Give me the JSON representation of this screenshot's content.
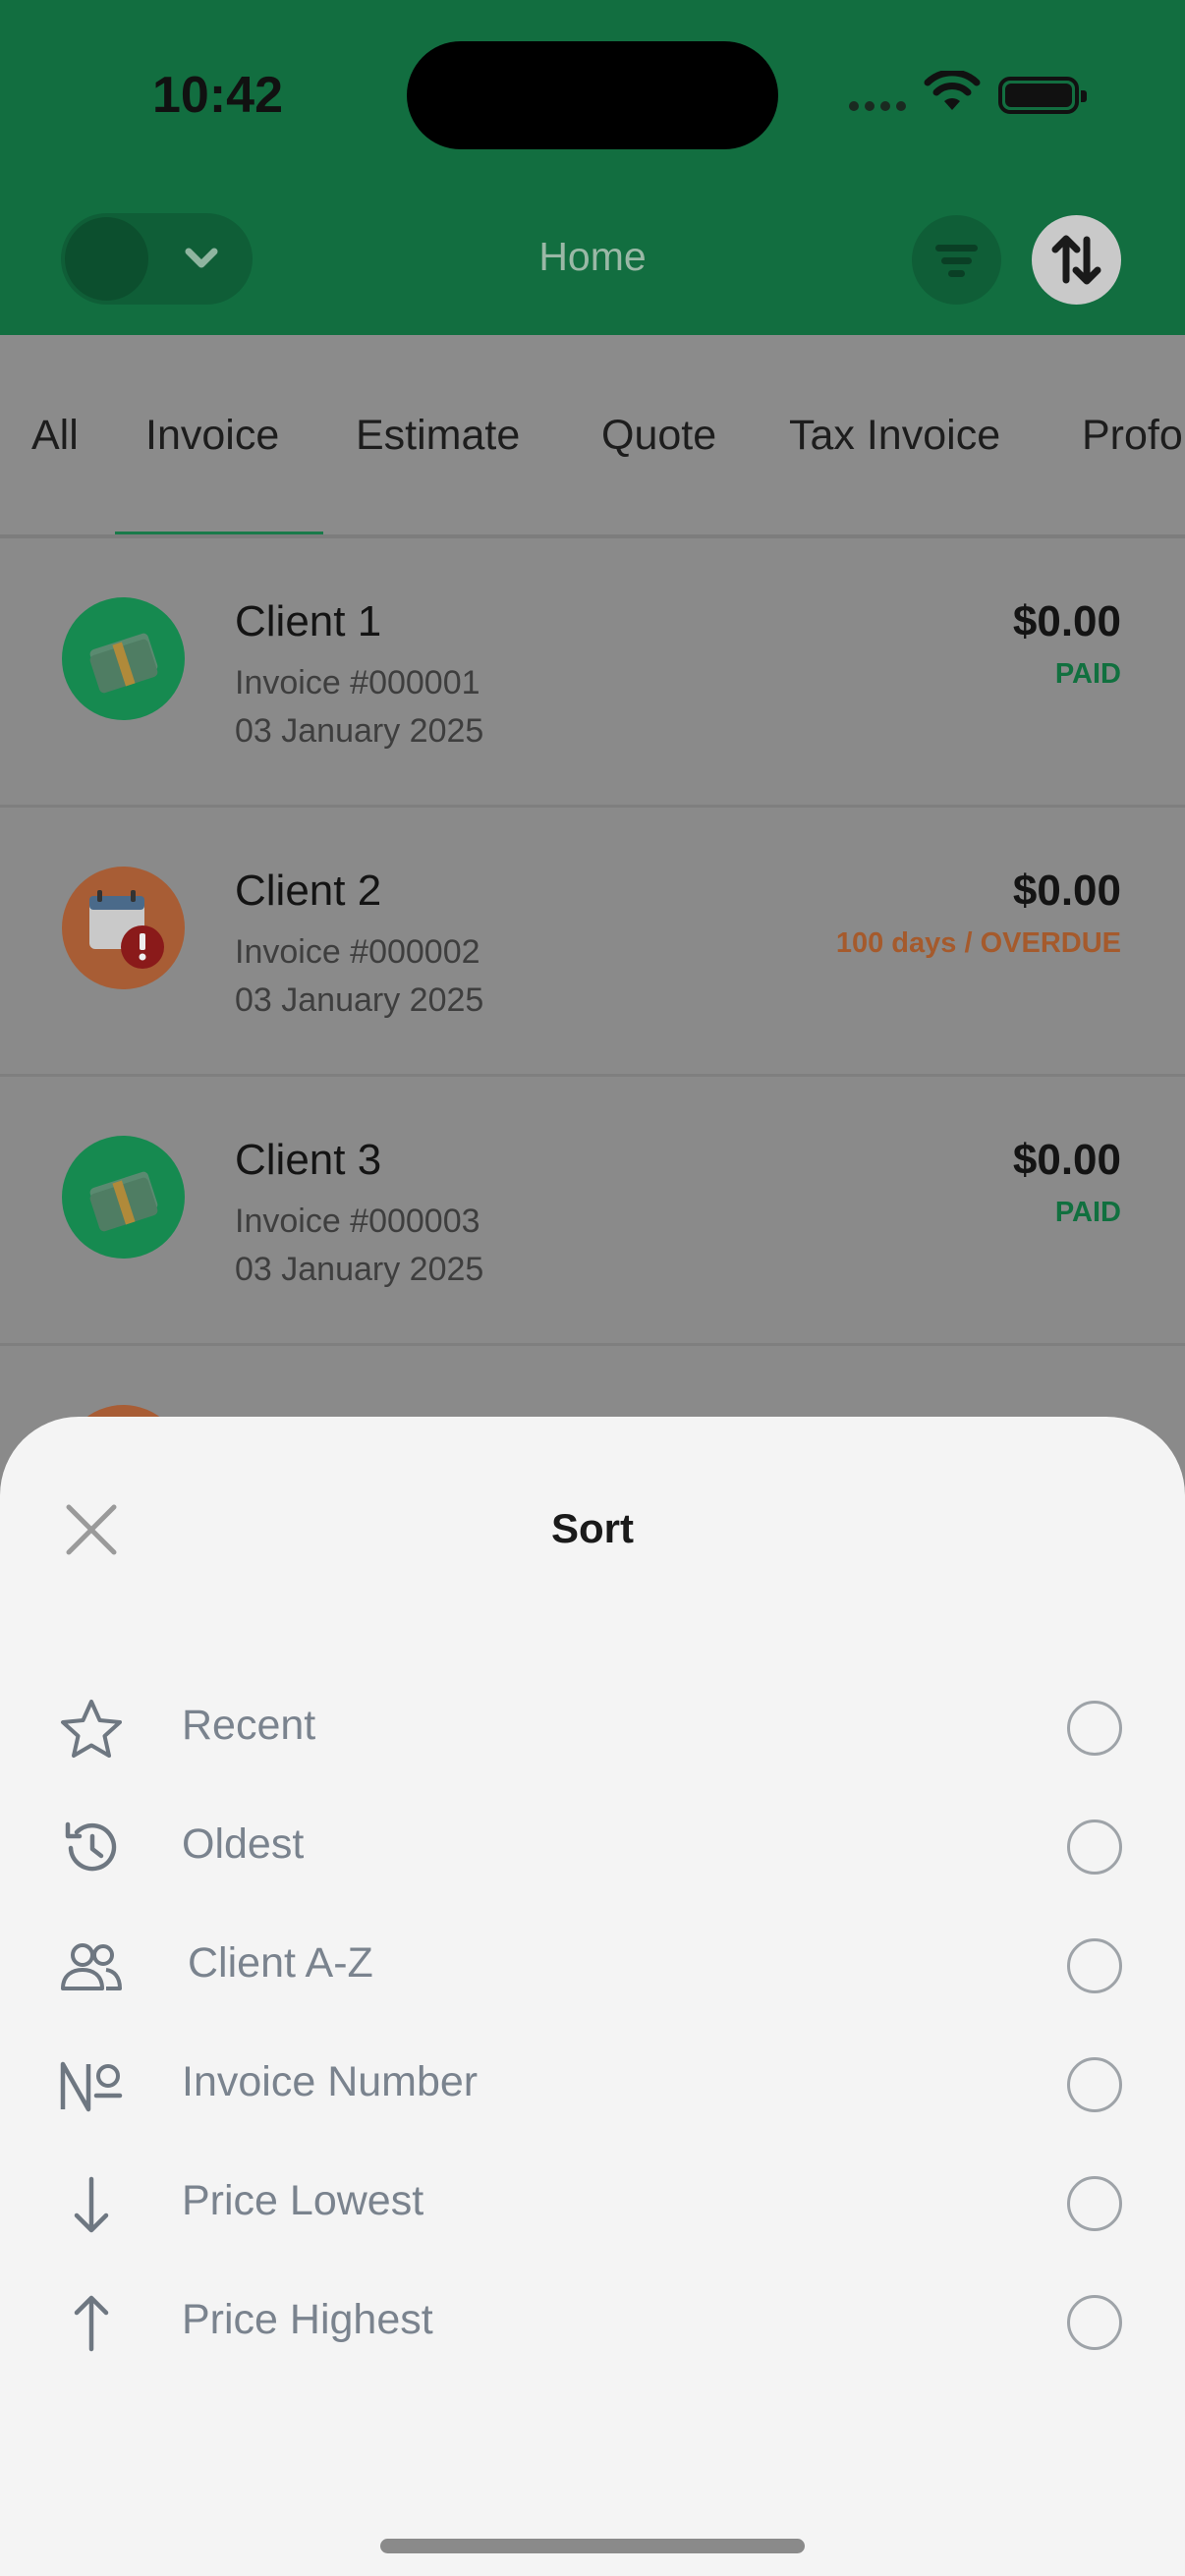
{
  "status_bar": {
    "time": "10:42"
  },
  "header": {
    "title": "Home"
  },
  "tabs": [
    {
      "label": "All",
      "active": false
    },
    {
      "label": "Invoice",
      "active": true
    },
    {
      "label": "Estimate",
      "active": false
    },
    {
      "label": "Quote",
      "active": false
    },
    {
      "label": "Tax Invoice",
      "active": false
    },
    {
      "label": "Proforma",
      "active": false
    }
  ],
  "invoices": [
    {
      "client": "Client 1",
      "number": "Invoice #000001",
      "date": "03 January 2025",
      "amount": "$0.00",
      "status": "PAID",
      "icon": "cash-icon"
    },
    {
      "client": "Client 2",
      "number": "Invoice #000002",
      "date": "03 January 2025",
      "amount": "$0.00",
      "status": "100 days / OVERDUE",
      "icon": "calendar-alert-icon"
    },
    {
      "client": "Client 3",
      "number": "Invoice #000003",
      "date": "03 January 2025",
      "amount": "$0.00",
      "status": "PAID",
      "icon": "cash-icon"
    }
  ],
  "sort_sheet": {
    "title": "Sort",
    "options": [
      {
        "label": "Recent",
        "icon": "star-icon",
        "selected": false
      },
      {
        "label": "Oldest",
        "icon": "history-icon",
        "selected": false
      },
      {
        "label": "Client A-Z",
        "icon": "clients-icon",
        "selected": false
      },
      {
        "label": "Invoice Number",
        "icon": "number-sign-icon",
        "selected": false
      },
      {
        "label": "Price Lowest",
        "icon": "arrow-down-icon",
        "selected": false
      },
      {
        "label": "Price Highest",
        "icon": "arrow-up-icon",
        "selected": false
      }
    ]
  },
  "colors": {
    "brand_green": "#14713f",
    "paid": "#11703f",
    "overdue": "#a55a2c",
    "sheet_background": "#f4f4f4"
  }
}
